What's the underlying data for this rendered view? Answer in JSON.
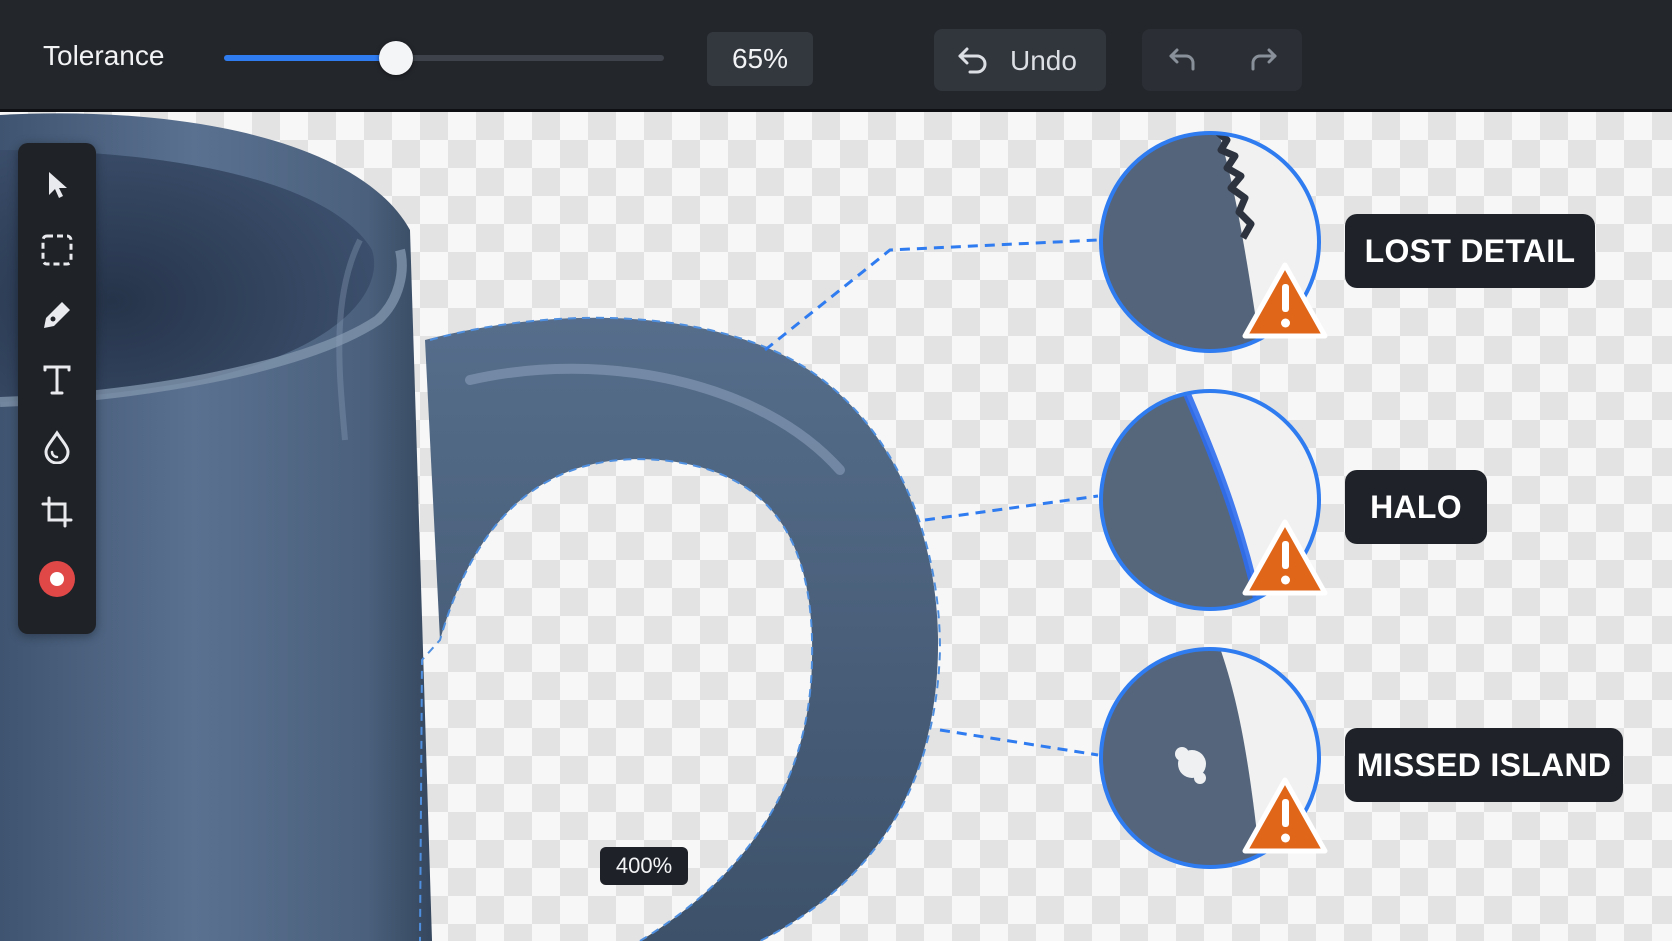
{
  "toolbar": {
    "tolerance_label": "Tolerance",
    "tolerance_value": 65,
    "tolerance_display": "65%",
    "undo_label": "Undo",
    "undo_icon": "undo-arrow-icon",
    "history_undo_icon": "undo-icon",
    "history_redo_icon": "redo-icon"
  },
  "tools": [
    {
      "name": "select-tool",
      "icon": "pointer-arrow-icon"
    },
    {
      "name": "marquee-tool",
      "icon": "dashed-rectangle-icon"
    },
    {
      "name": "pen-tool",
      "icon": "pen-nib-icon"
    },
    {
      "name": "text-tool",
      "icon": "text-t-icon"
    },
    {
      "name": "fill-tool",
      "icon": "paint-drop-icon"
    },
    {
      "name": "crop-tool",
      "icon": "crop-icon"
    },
    {
      "name": "record-tool",
      "icon": "record-icon"
    }
  ],
  "callouts": [
    {
      "label": "LOST DETAIL",
      "issue": "jagged edge",
      "icon": "warning-icon"
    },
    {
      "label": "HALO",
      "issue": "blue fringe",
      "icon": "warning-icon"
    },
    {
      "label": "MISSED ISLAND",
      "issue": "unremoved speck",
      "icon": "warning-icon"
    }
  ],
  "zoom_level": "400%",
  "colors": {
    "accent": "#2f7bf0",
    "warning": "#e0661a",
    "mug": "#4c627c",
    "toolbar_bg": "#23262b",
    "record": "#e04848"
  }
}
